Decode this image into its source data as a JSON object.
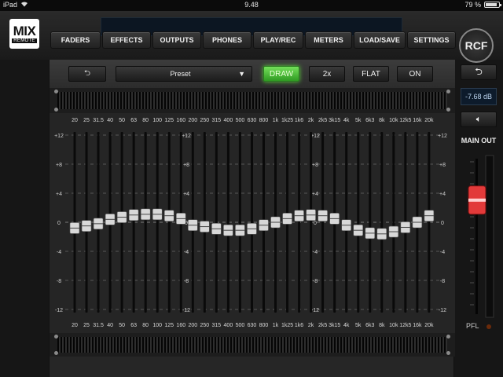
{
  "status": {
    "device": "iPad",
    "time": "9.48",
    "battery": "79 %",
    "battery_level": 0.79
  },
  "logo": {
    "line1": "MIX",
    "line2": "REMOTE"
  },
  "brand": "RCF",
  "tabs": [
    "FADERS",
    "EFFECTS",
    "OUTPUTS",
    "PHONES",
    "PLAY/REC",
    "METERS",
    "LOAD/SAVE",
    "SETTINGS"
  ],
  "toolbar": {
    "undo": "⮌",
    "preset_label": "Preset",
    "preset_arrow": "▼",
    "draw": "DRAW",
    "zoom": "2x",
    "flat": "FLAT",
    "on": "ON"
  },
  "right": {
    "undo": "⮌",
    "db_value": "-7.68 dB",
    "mute_icon": "🔈︎",
    "main_out": "MAIN OUT",
    "pfl": "PFL",
    "main_fader_db": -4,
    "scale": [
      "",
      "",
      "",
      "",
      "",
      "",
      ""
    ]
  },
  "eq": {
    "frequencies": [
      "20",
      "25",
      "31.5",
      "40",
      "50",
      "63",
      "80",
      "100",
      "125",
      "160",
      "200",
      "250",
      "315",
      "400",
      "500",
      "630",
      "800",
      "1k",
      "1k25",
      "1k6",
      "2k",
      "2k5",
      "3k15",
      "4k",
      "5k",
      "6k3",
      "8k",
      "10k",
      "12k5",
      "16k",
      "20k"
    ],
    "scale_labels": [
      "+12",
      "+8",
      "+4",
      "0",
      "-4",
      "-8",
      "-12"
    ],
    "scale_values": [
      12,
      8,
      4,
      0,
      -4,
      -8,
      -12
    ],
    "gains": [
      -0.8,
      -0.5,
      -0.2,
      0.4,
      0.7,
      1.0,
      1.1,
      1.1,
      0.9,
      0.5,
      -0.4,
      -0.6,
      -0.9,
      -1.1,
      -1.1,
      -0.9,
      -0.4,
      0.0,
      0.5,
      0.9,
      1.0,
      0.9,
      0.5,
      -0.4,
      -1.1,
      -1.5,
      -1.6,
      -1.3,
      -0.7,
      0.0,
      0.9
    ],
    "range": [
      -12,
      12
    ],
    "colors": {
      "grid": "#6a6a6a",
      "slot": "#0a0a0a",
      "knob": "#d8d8d8",
      "accent": "#5ccf3e",
      "fader_red": "#e23a3a"
    }
  }
}
